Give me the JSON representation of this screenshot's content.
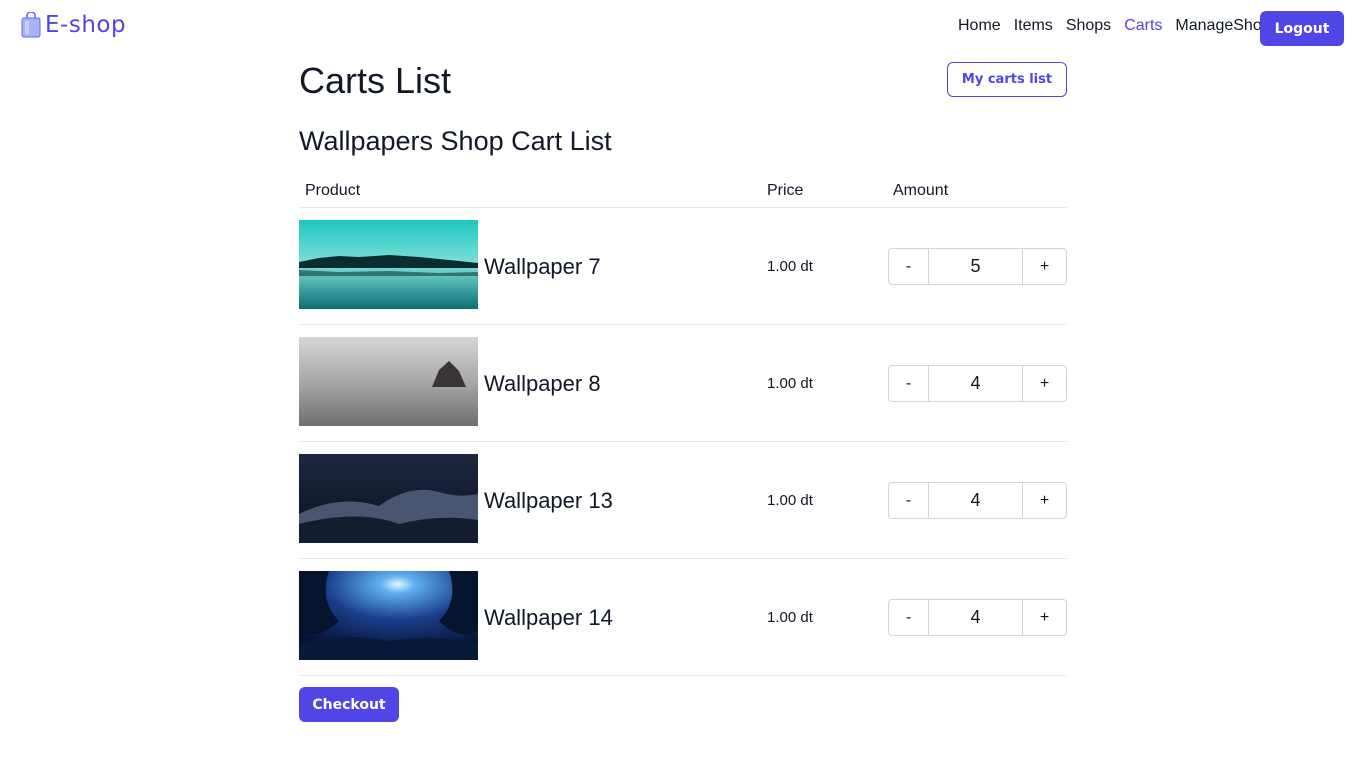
{
  "navbar": {
    "brand": "E-shop",
    "brand_icon": "shopping-bag-icon",
    "links": [
      "Home",
      "Items",
      "Shops",
      "Carts",
      "ManageShops"
    ],
    "active_link": "Carts",
    "logout_label": "Logout"
  },
  "page": {
    "title": "Carts List",
    "my_carts_label": "My carts list",
    "shop_title": "Wallpapers Shop Cart List"
  },
  "table": {
    "headers": {
      "product": "Product",
      "price": "Price",
      "amount": "Amount"
    },
    "rows": [
      {
        "name": "Wallpaper 7",
        "price": "1.00 dt",
        "amount": "5"
      },
      {
        "name": "Wallpaper 8",
        "price": "1.00 dt",
        "amount": "4"
      },
      {
        "name": "Wallpaper 13",
        "price": "1.00 dt",
        "amount": "4"
      },
      {
        "name": "Wallpaper 14",
        "price": "1.00 dt",
        "amount": "4"
      }
    ],
    "decrement_label": "-",
    "increment_label": "+"
  },
  "checkout_label": "Checkout",
  "colors": {
    "accent": "#4f46e5",
    "border": "#e5e7eb"
  }
}
